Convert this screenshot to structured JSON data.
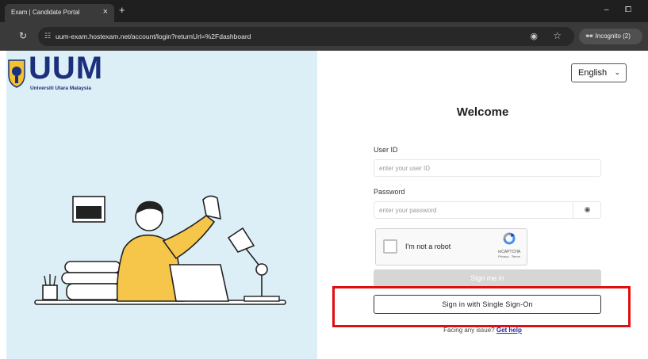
{
  "browser": {
    "tab_title": "Exam | Candidate Portal",
    "tab_close": "×",
    "new_tab": "+",
    "minimize": "–",
    "maximize": "⧠",
    "url": "uum-exam.hostexam.net/account/login?returnUrl=%2Fdashboard",
    "incognito_label": "Incognito (2)"
  },
  "brand": {
    "logo_text": "UUM",
    "university_name": "Universiti Utara Malaysia",
    "primary_color": "#1c2f7a"
  },
  "login": {
    "language": "English",
    "title": "Welcome",
    "user_id_label": "User ID",
    "user_id_placeholder": "enter your user ID",
    "password_label": "Password",
    "password_placeholder": "enter your password",
    "recaptcha_text": "I'm not a robot",
    "recaptcha_brand": "reCAPTCHA",
    "recaptcha_links": "Privacy - Terms",
    "sign_in_label": "Sign me in",
    "sso_label": "Sign in with Single Sign-On",
    "help_text": "Facing any issue?",
    "help_link": "Get help"
  },
  "colors": {
    "left_panel_bg": "#ddeff6",
    "highlight_border": "#e10e0e",
    "disabled_button": "#d6d6d6"
  }
}
